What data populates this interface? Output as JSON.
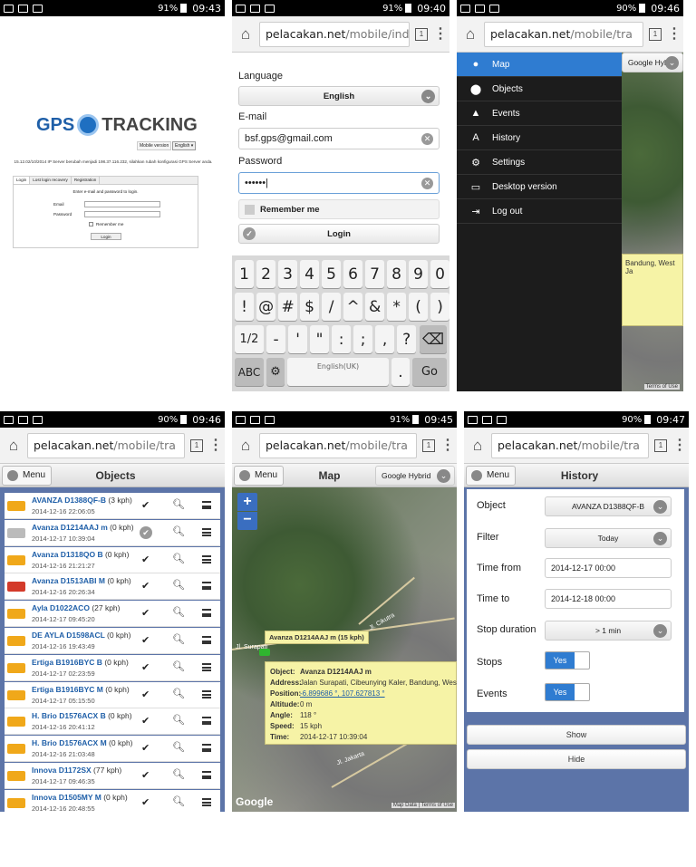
{
  "status": {
    "times": [
      "09:43",
      "09:40",
      "09:46",
      "09:46",
      "09:45",
      "09:47"
    ],
    "battery": [
      "91%",
      "91%",
      "90%",
      "90%",
      "91%",
      "90%"
    ]
  },
  "browser": {
    "url_host": "pelacakan.net",
    "url_path_login": "/mobile/indé",
    "url_path": "/mobile/tra",
    "tab_count": "1"
  },
  "login_desktop": {
    "logo_left": "GPS",
    "logo_right": "TRACKING",
    "mobile_version": "Mobile version",
    "lang": "English",
    "notice": "15.12.02/10/2014 IP Server berubah menjadi 198.37.116.232, silahkan rubah konfigurasi GPS Server anda.",
    "tabs": [
      "Login",
      "Lost login recovery",
      "Registration"
    ],
    "intro": "Enter e-mail and password to login.",
    "email_label": "Email",
    "password_label": "Password",
    "remember": "Remember me",
    "login_btn": "Login"
  },
  "login_mobile": {
    "language_label": "Language",
    "language_value": "English",
    "email_label": "E-mail",
    "email_value": "bsf.gps@gmail.com",
    "password_label": "Password",
    "password_value": "••••••|",
    "remember": "Remember me",
    "login_btn": "Login"
  },
  "keyboard": {
    "row1": [
      "1",
      "2",
      "3",
      "4",
      "5",
      "6",
      "7",
      "8",
      "9",
      "0"
    ],
    "row2": [
      "!",
      "@",
      "#",
      "$",
      "/",
      "^",
      "&",
      "*",
      "(",
      ")"
    ],
    "row3": [
      "1/2",
      "-",
      "'",
      "\"",
      ":",
      ";",
      ",",
      "?"
    ],
    "abc": "ABC",
    "space": "English(UK)",
    "dot": ".",
    "go": "Go"
  },
  "menu": {
    "items": [
      {
        "label": "Map",
        "icon": "●"
      },
      {
        "label": "Objects",
        "icon": "⬤"
      },
      {
        "label": "Events",
        "icon": "▲"
      },
      {
        "label": "History",
        "icon": "A"
      },
      {
        "label": "Settings",
        "icon": "⚙"
      },
      {
        "label": "Desktop version",
        "icon": "▭"
      },
      {
        "label": "Log out",
        "icon": "⇥"
      }
    ],
    "map_type": "Google Hybrid",
    "behind_text": "Bandung, West Ja",
    "attrib": "Terms of Use"
  },
  "objects": {
    "menu_label": "Menu",
    "title": "Objects",
    "rows": [
      {
        "name": "AVANZA D1388QF-B",
        "speed": "(3 kph)",
        "date": "2014-12-16 22:06:05",
        "color": "#f0a81a"
      },
      {
        "name": "Avanza D1214AAJ m",
        "speed": "(0 kph)",
        "date": "2014-12-17 10:39:04",
        "color": "#bbbbbb"
      },
      {
        "name": "Avanza D1318QO B",
        "speed": "(0 kph)",
        "date": "2014-12-16 21:21:27",
        "color": "#f0a81a"
      },
      {
        "name": "Avanza D1513ABI M",
        "speed": "(0 kph)",
        "date": "2014-12-16 20:26:34",
        "color": "#d33a2a"
      },
      {
        "name": "Ayla D1022ACO",
        "speed": "(27 kph)",
        "date": "2014-12-17 09:45:20",
        "color": "#f0a81a"
      },
      {
        "name": "DE AYLA D1598ACL",
        "speed": "(0 kph)",
        "date": "2014-12-16 19:43:49",
        "color": "#f0a81a"
      },
      {
        "name": "Ertiga B1916BYC B",
        "speed": "(0 kph)",
        "date": "2014-12-17 02:23:59",
        "color": "#f0a81a"
      },
      {
        "name": "Ertiga B1916BYC M",
        "speed": "(0 kph)",
        "date": "2014-12-17 05:15:50",
        "color": "#f0a81a"
      },
      {
        "name": "H. Brio D1576ACX B",
        "speed": "(0 kph)",
        "date": "2014-12-16 20:41:12",
        "color": "#f0a81a"
      },
      {
        "name": "H. Brio D1576ACX M",
        "speed": "(0 kph)",
        "date": "2014-12-16 21:03:48",
        "color": "#f0a81a"
      },
      {
        "name": "Innova D1172SX",
        "speed": "(77 kph)",
        "date": "2014-12-17 09:46:35",
        "color": "#f0a81a"
      },
      {
        "name": "Innova D1505MY M",
        "speed": "(0 kph)",
        "date": "2014-12-16 20:48:55",
        "color": "#f0a81a"
      }
    ]
  },
  "mapview": {
    "menu_label": "Menu",
    "title": "Map",
    "map_type": "Google Hybrid",
    "zoom_in": "+",
    "zoom_out": "−",
    "marker_label": "Avanza D1214AAJ m (15 kph)",
    "street1": "Jl. Cikutra",
    "street2": "Jl. Surapati",
    "street3": "Jl. Jakarta",
    "popup": [
      {
        "k": "Object:",
        "v": "Avanza D1214AAJ m"
      },
      {
        "k": "Address:",
        "v": "Jalan Surapati, Cibeunying Kaler, Bandung, West Ja"
      },
      {
        "k": "Position:",
        "v": "-6.899686 °, 107.627813 °"
      },
      {
        "k": "Altitude:",
        "v": "0 m"
      },
      {
        "k": "Angle:",
        "v": "118 °"
      },
      {
        "k": "Speed:",
        "v": "15 kph"
      },
      {
        "k": "Time:",
        "v": "2014-12-17 10:39:04"
      }
    ],
    "google": "Google",
    "attrib1": "Map Data",
    "attrib2": "Terms of Use"
  },
  "history": {
    "menu_label": "Menu",
    "title": "History",
    "object_label": "Object",
    "object_value": "AVANZA D1388QF-B",
    "filter_label": "Filter",
    "filter_value": "Today",
    "from_label": "Time from",
    "from_value": "2014-12-17 00:00",
    "to_label": "Time to",
    "to_value": "2014-12-18 00:00",
    "stop_label": "Stop duration",
    "stop_value": "> 1 min",
    "stops_label": "Stops",
    "events_label": "Events",
    "yes": "Yes",
    "show_btn": "Show",
    "hide_btn": "Hide"
  }
}
